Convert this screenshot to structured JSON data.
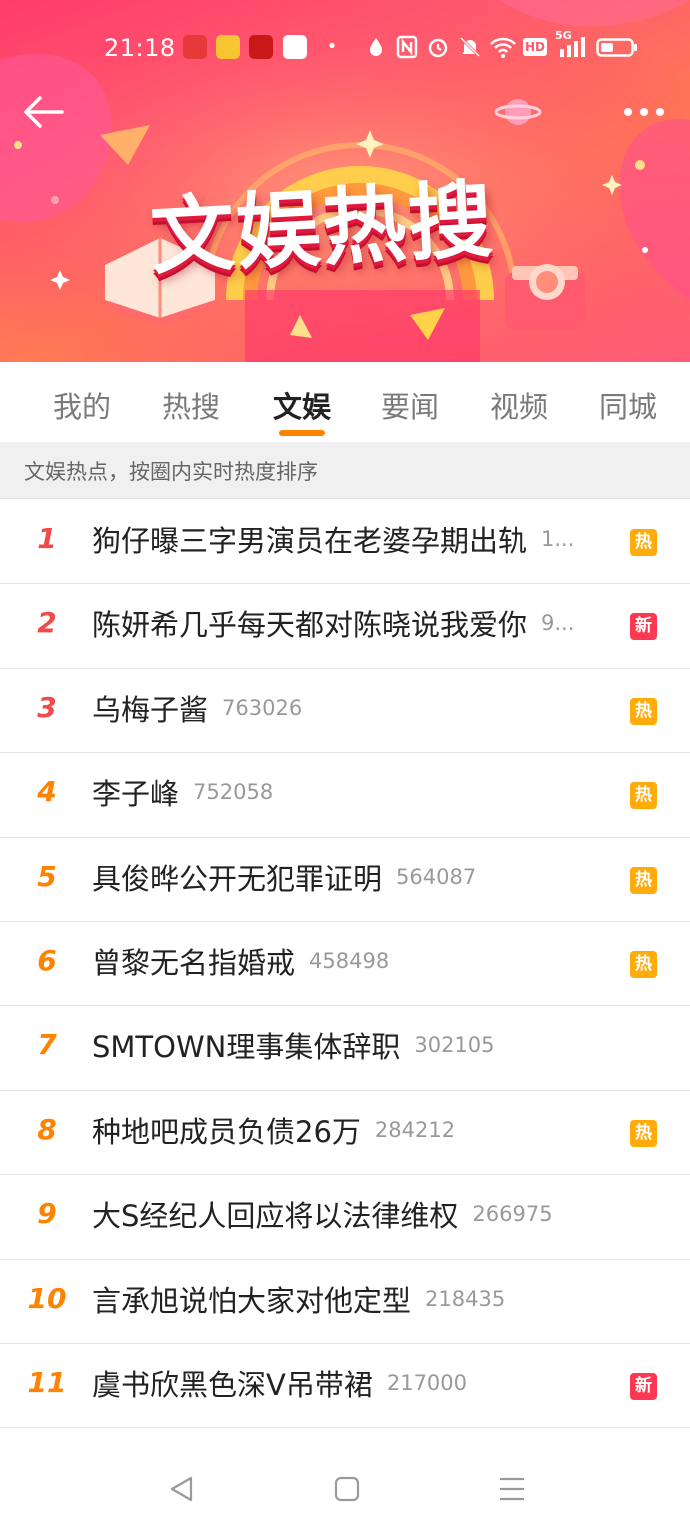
{
  "status_bar": {
    "time": "21:18",
    "app_icons": [
      "netease-music-icon",
      "weibo-icon",
      "app-icon",
      "app-icon"
    ],
    "right_icons": [
      "dot-icon",
      "drop-icon",
      "nfc-icon",
      "alarm-icon",
      "mute-icon",
      "wifi-icon",
      "hd-icon",
      "5g-signal-icon",
      "battery-icon"
    ],
    "hd_label": "HD",
    "net_label": "5G"
  },
  "banner": {
    "title": "文娱热搜",
    "colors": {
      "primary": "#ff3c6a",
      "accent": "#ffd24a"
    }
  },
  "tabs": [
    {
      "label": "我的",
      "active": false
    },
    {
      "label": "热搜",
      "active": false
    },
    {
      "label": "文娱",
      "active": true
    },
    {
      "label": "要闻",
      "active": false
    },
    {
      "label": "视频",
      "active": false
    },
    {
      "label": "同城",
      "active": false
    }
  ],
  "subheader": "文娱热点，按圈内实时热度排序",
  "list": [
    {
      "rank": "1",
      "title": "狗仔曝三字男演员在老婆孕期出轨",
      "count": "1...",
      "badge": "热",
      "badge_type": "hot"
    },
    {
      "rank": "2",
      "title": "陈妍希几乎每天都对陈晓说我爱你",
      "count": "9...",
      "badge": "新",
      "badge_type": "new"
    },
    {
      "rank": "3",
      "title": "乌梅子酱",
      "count": "763026",
      "badge": "热",
      "badge_type": "hot"
    },
    {
      "rank": "4",
      "title": "李子峰",
      "count": "752058",
      "badge": "热",
      "badge_type": "hot"
    },
    {
      "rank": "5",
      "title": "具俊晔公开无犯罪证明",
      "count": "564087",
      "badge": "热",
      "badge_type": "hot"
    },
    {
      "rank": "6",
      "title": "曾黎无名指婚戒",
      "count": "458498",
      "badge": "热",
      "badge_type": "hot"
    },
    {
      "rank": "7",
      "title": "SMTOWN理事集体辞职",
      "count": "302105",
      "badge": "",
      "badge_type": "none"
    },
    {
      "rank": "8",
      "title": "种地吧成员负债26万",
      "count": "284212",
      "badge": "热",
      "badge_type": "hot"
    },
    {
      "rank": "9",
      "title": "大S经纪人回应将以法律维权",
      "count": "266975",
      "badge": "",
      "badge_type": "none"
    },
    {
      "rank": "10",
      "title": "言承旭说怕大家对他定型",
      "count": "218435",
      "badge": "",
      "badge_type": "none"
    },
    {
      "rank": "11",
      "title": "虞书欣黑色深V吊带裙",
      "count": "217000",
      "badge": "新",
      "badge_type": "new"
    }
  ],
  "nav": [
    "back-triangle-icon",
    "home-square-icon",
    "menu-lines-icon"
  ]
}
